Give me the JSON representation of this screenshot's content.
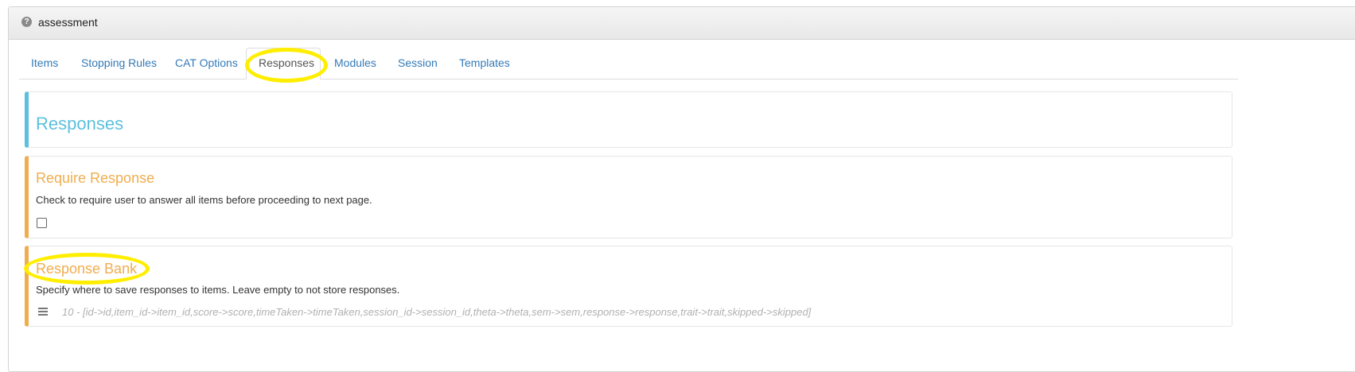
{
  "panel": {
    "title": "assessment",
    "help_icon_glyph": "?"
  },
  "tabs": [
    {
      "label": "Items"
    },
    {
      "label": "Stopping Rules"
    },
    {
      "label": "CAT Options"
    },
    {
      "label": "Responses",
      "active": true
    },
    {
      "label": "Modules"
    },
    {
      "label": "Session"
    },
    {
      "label": "Templates"
    }
  ],
  "sections": {
    "header": {
      "title": "Responses"
    },
    "require_response": {
      "title": "Require Response",
      "description": "Check to require user to answer all items before proceeding to next page.",
      "checked": false
    },
    "response_bank": {
      "title": "Response Bank",
      "description": "Specify where to save responses to items. Leave empty to not store responses.",
      "value": "10 - [id->id,item_id->item_id,score->score,timeTaken->timeTaken,session_id->session_id,theta->theta,sem->sem,response->response,trait->trait,skipped->skipped]"
    }
  },
  "colors": {
    "link": "#337ab7",
    "info_border": "#5bc0de",
    "warning_border": "#f0ad4e",
    "highlight": "#ffee00"
  }
}
